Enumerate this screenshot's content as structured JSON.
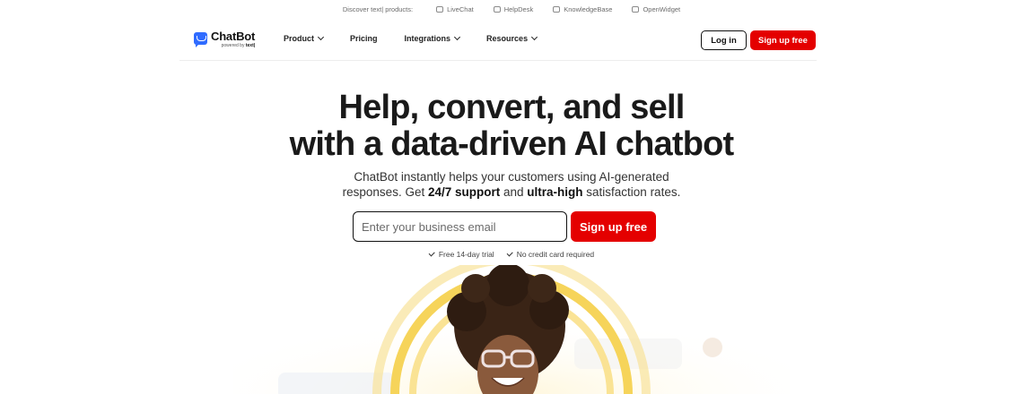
{
  "topbar": {
    "discover": "Discover text| products:",
    "products": [
      {
        "label": "LiveChat",
        "icon": "chat-icon"
      },
      {
        "label": "HelpDesk",
        "icon": "ticket-icon"
      },
      {
        "label": "KnowledgeBase",
        "icon": "folder-icon"
      },
      {
        "label": "OpenWidget",
        "icon": "widget-icon"
      }
    ]
  },
  "header": {
    "logo": {
      "name": "ChatBot",
      "powered_prefix": "powered by ",
      "powered_brand": "text|"
    },
    "nav": [
      {
        "label": "Product",
        "dropdown": true
      },
      {
        "label": "Pricing",
        "dropdown": false
      },
      {
        "label": "Integrations",
        "dropdown": true
      },
      {
        "label": "Resources",
        "dropdown": true
      }
    ],
    "login_label": "Log in",
    "signup_label": "Sign up free"
  },
  "hero": {
    "title_line1": "Help, convert, and sell",
    "title_line2": "with a data-driven AI chatbot",
    "subtitle_line1": "ChatBot instantly helps your customers using AI-generated",
    "subtitle_line2_a": "responses. Get ",
    "subtitle_line2_b": "24/7 support",
    "subtitle_line2_c": " and ",
    "subtitle_line2_d": "ultra-high",
    "subtitle_line2_e": " satisfaction rates.",
    "email_placeholder": "Enter your business email",
    "signup_label": "Sign up free",
    "checks": [
      "Free 14-day trial",
      "No credit card required"
    ]
  },
  "colors": {
    "brand_red": "#e40000",
    "brand_blue": "#2f6bff",
    "text_dark": "#1a1a1a",
    "arc_yellow": "#f7cf3e"
  }
}
